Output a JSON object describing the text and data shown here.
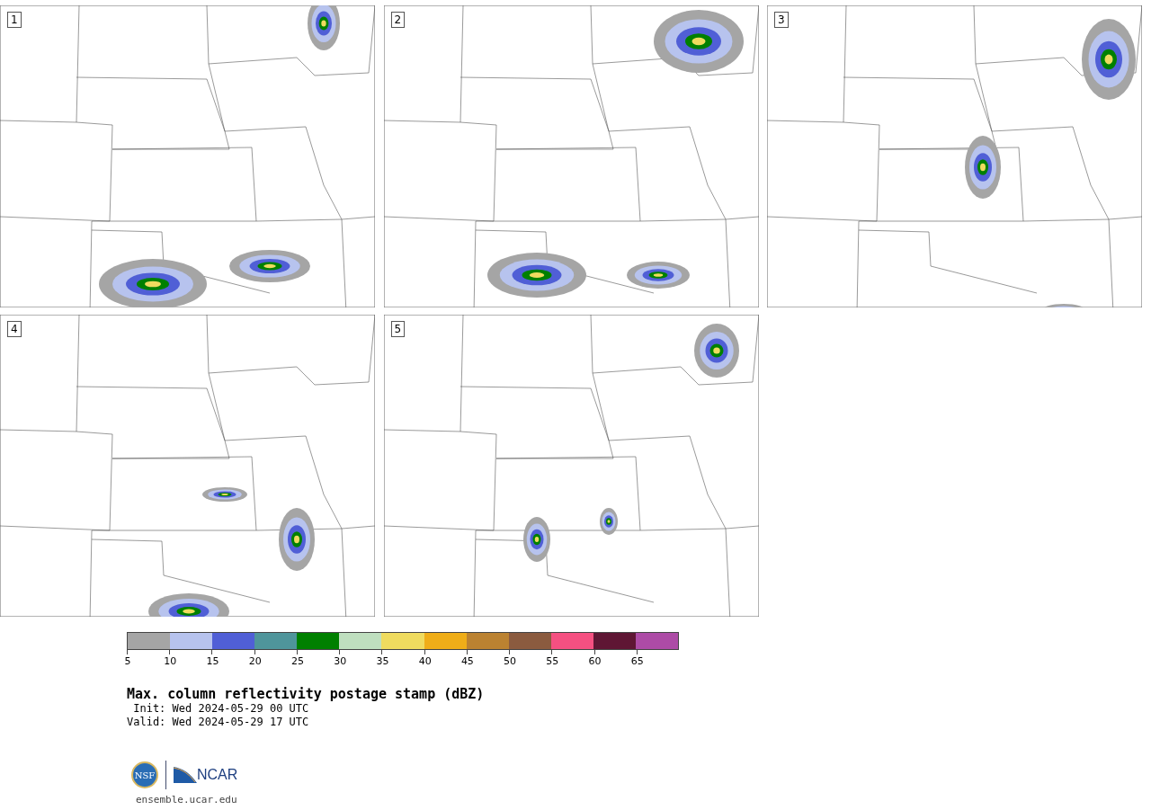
{
  "panels": [
    {
      "label": "1"
    },
    {
      "label": "2"
    },
    {
      "label": "3"
    },
    {
      "label": "4"
    },
    {
      "label": "5"
    }
  ],
  "colorbar": [
    {
      "tick": "5",
      "color": "#a5a5a5"
    },
    {
      "tick": "10",
      "color": "#b7c3ee"
    },
    {
      "tick": "15",
      "color": "#505fd6"
    },
    {
      "tick": "20",
      "color": "#4f959b"
    },
    {
      "tick": "25",
      "color": "#008000"
    },
    {
      "tick": "30",
      "color": "#bfdfbf"
    },
    {
      "tick": "35",
      "color": "#efdb5f"
    },
    {
      "tick": "40",
      "color": "#efad18"
    },
    {
      "tick": "45",
      "color": "#bb8231"
    },
    {
      "tick": "50",
      "color": "#8b5b3f"
    },
    {
      "tick": "55",
      "color": "#f55081"
    },
    {
      "tick": "60",
      "color": "#5f1634"
    },
    {
      "tick": "65",
      "color": "#ad4ba6"
    }
  ],
  "title": "Max. column reflectivity postage stamp (dBZ)",
  "init": " Init: Wed 2024-05-29 00 UTC",
  "valid": "Valid: Wed 2024-05-29 17 UTC",
  "logos": {
    "nsf": "NSF",
    "ncar": "NCAR"
  },
  "site": "ensemble.ucar.edu"
}
